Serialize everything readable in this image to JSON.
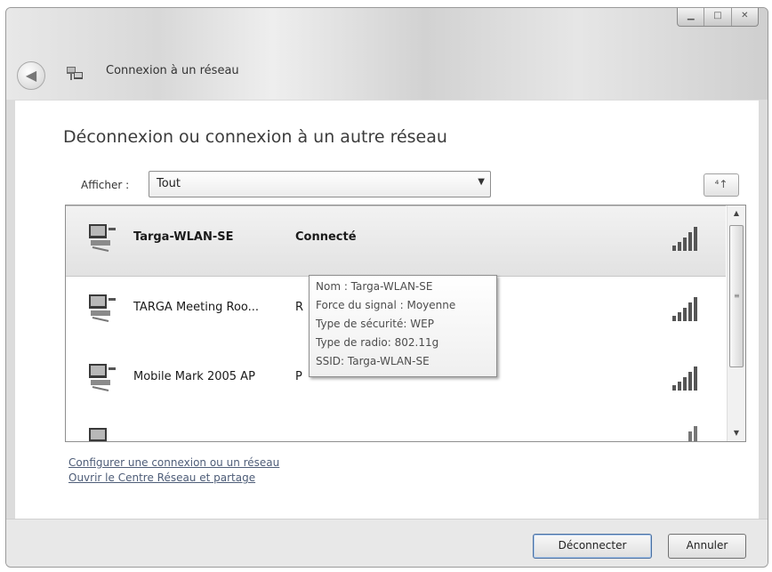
{
  "window": {
    "title": "Connexion à un réseau",
    "controls": [
      "▁",
      "□",
      "✕"
    ],
    "back_glyph": "◀"
  },
  "main": {
    "heading": "Déconnexion ou connexion à un autre réseau",
    "filter_label": "Afficher :",
    "filter_value": "Tout",
    "refresh_glyph": "⁴↑"
  },
  "networks": [
    {
      "name": "Targa-WLAN-SE",
      "status": "Connecté"
    },
    {
      "name": "TARGA Meeting Roo...",
      "status": "R"
    },
    {
      "name": "Mobile Mark 2005 AP",
      "status": "P"
    }
  ],
  "tooltip": {
    "line1": "Nom : Targa-WLAN-SE",
    "line2": "Force du signal : Moyenne",
    "line3": "Type de sécurité: WEP",
    "line4": "Type de radio: 802.11g",
    "line5": "SSID: Targa-WLAN-SE"
  },
  "links": {
    "setup": "Configurer une connexion ou un réseau",
    "center": "Ouvrir le Centre Réseau et partage"
  },
  "buttons": {
    "disconnect": "Déconnecter",
    "cancel": "Annuler"
  },
  "colors": {
    "link": "#4e5d78",
    "selected_row": "#e6e6e6"
  }
}
